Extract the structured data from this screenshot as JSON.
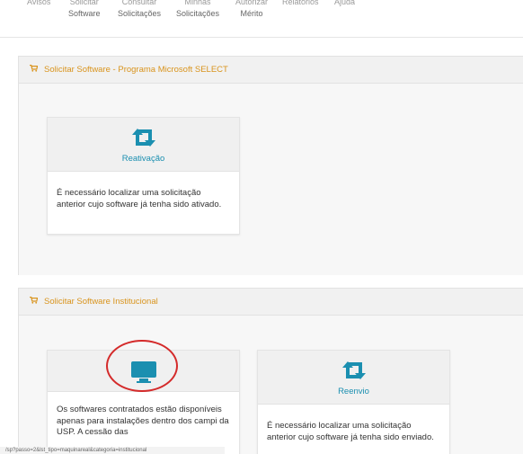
{
  "nav": {
    "items": [
      {
        "line1": "Avisos",
        "line2": ""
      },
      {
        "line1": "Solicitar",
        "line2": "Software"
      },
      {
        "line1": "Consultar",
        "line2": "Solicitações"
      },
      {
        "line1": "Minhas",
        "line2": "Solicitações"
      },
      {
        "line1": "Autorizar",
        "line2": "Mérito"
      },
      {
        "line1": "Relatórios",
        "line2": ""
      },
      {
        "line1": "Ajuda",
        "line2": ""
      }
    ]
  },
  "panel1": {
    "title": "Solicitar Software - Programa Microsoft SELECT",
    "cards": [
      {
        "title": "Reativação",
        "text": "É necessário localizar uma solicitação anterior cujo software já tenha sido ativado."
      }
    ]
  },
  "panel2": {
    "title": "Solicitar Software Institucional",
    "cards": [
      {
        "title": "",
        "text": "Os softwares contratados estão disponíveis apenas para instalações dentro dos campi da USP. A cessão das"
      },
      {
        "title": "Reenvio",
        "text": "É necessário localizar uma solicitação anterior cujo software já tenha sido enviado."
      }
    ]
  },
  "status_url": "/sp?passo=2&lst_tipo=maquinareal&categoria=institucional",
  "colors": {
    "accent": "#1b8fb0",
    "heading": "#d9941d",
    "highlight": "#d42a2a"
  }
}
